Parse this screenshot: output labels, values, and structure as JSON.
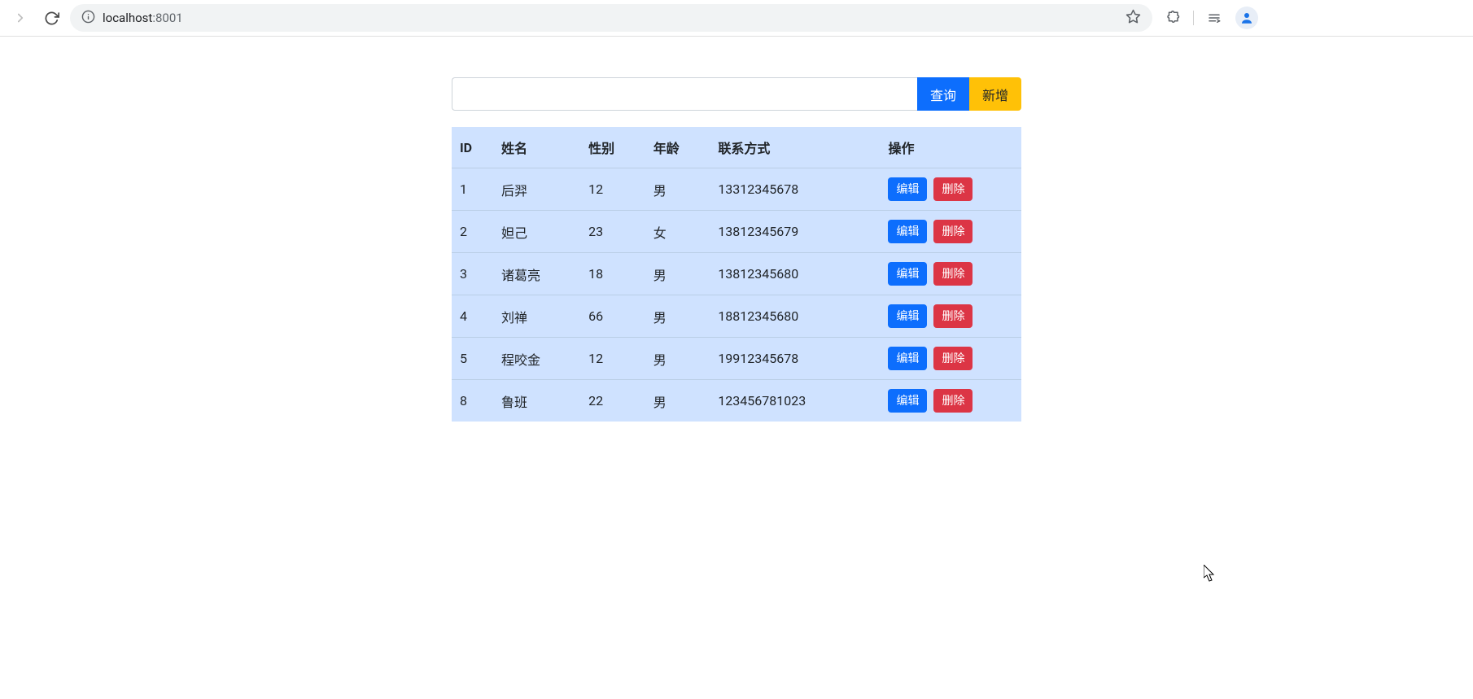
{
  "browser": {
    "url_host": "localhost",
    "url_port": ":8001"
  },
  "toolbar": {
    "search_value": "",
    "query_label": "查询",
    "add_label": "新增"
  },
  "table": {
    "headers": {
      "id": "ID",
      "name": "姓名",
      "gender": "性别",
      "age": "年龄",
      "contact": "联系方式",
      "action": "操作"
    },
    "action_labels": {
      "edit": "编辑",
      "delete": "删除"
    },
    "rows": [
      {
        "id": "1",
        "name": "后羿",
        "gender": "12",
        "age": "男",
        "contact": "13312345678"
      },
      {
        "id": "2",
        "name": "妲己",
        "gender": "23",
        "age": "女",
        "contact": "13812345679"
      },
      {
        "id": "3",
        "name": "诸葛亮",
        "gender": "18",
        "age": "男",
        "contact": "13812345680"
      },
      {
        "id": "4",
        "name": "刘禅",
        "gender": "66",
        "age": "男",
        "contact": "18812345680"
      },
      {
        "id": "5",
        "name": "程咬金",
        "gender": "12",
        "age": "男",
        "contact": "19912345678"
      },
      {
        "id": "8",
        "name": "鲁班",
        "gender": "22",
        "age": "男",
        "contact": "123456781023"
      }
    ]
  }
}
